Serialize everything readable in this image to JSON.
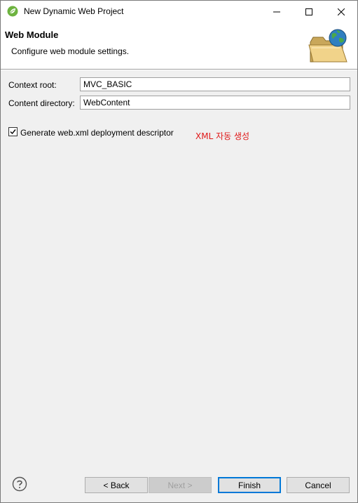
{
  "window": {
    "title": "New Dynamic Web Project"
  },
  "header": {
    "title": "Web Module",
    "description": "Configure web module settings."
  },
  "form": {
    "context_root_label": "Context root:",
    "context_root_value": "MVC_BASIC",
    "content_directory_label": "Content directory:",
    "content_directory_value": "WebContent",
    "generate_label": "Generate web.xml deployment descriptor",
    "generate_checked": true
  },
  "annotation": "XML 자동 생성",
  "buttons": {
    "back": "< Back",
    "next": "Next >",
    "finish": "Finish",
    "cancel": "Cancel"
  },
  "icons": {
    "app": "eclipse-spring-icon",
    "header": "folder-globe-icon",
    "help": "help-icon"
  },
  "colors": {
    "annotation": "#e01b1b",
    "default_button_border": "#0078d7"
  }
}
